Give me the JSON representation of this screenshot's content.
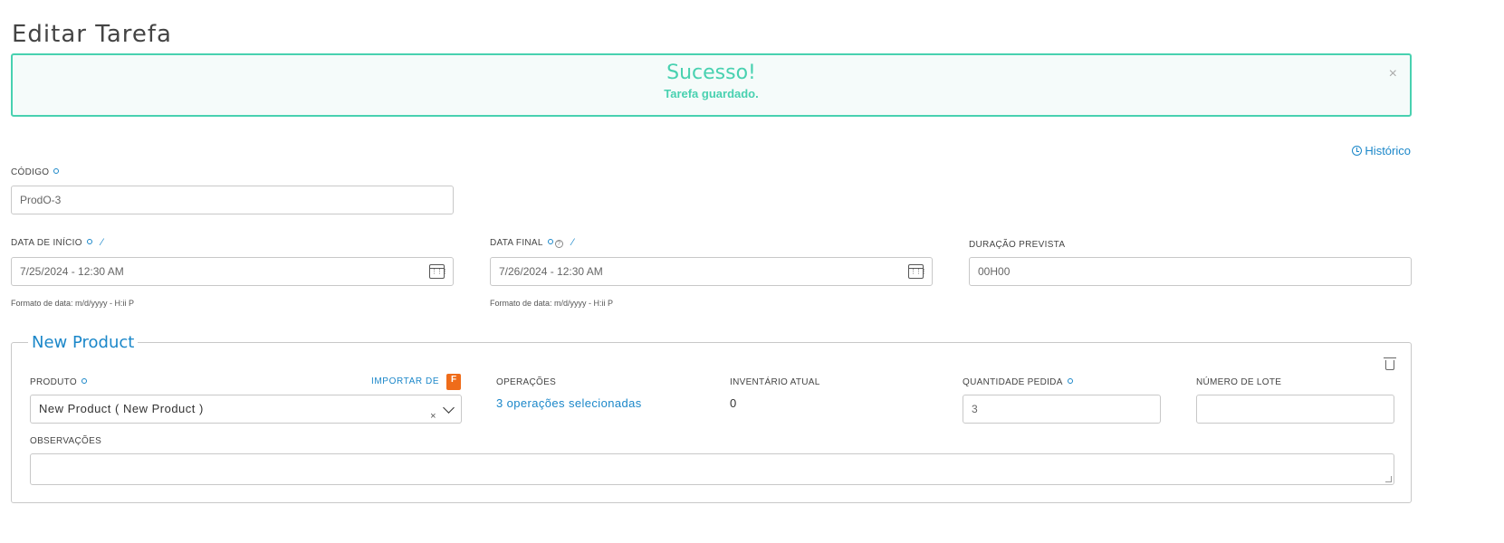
{
  "page": {
    "title": "Editar Tarefa"
  },
  "alert": {
    "title": "Sucesso!",
    "message": "Tarefa guardado.",
    "close_symbol": "×"
  },
  "history": {
    "label": "Histórico",
    "icon": "clock-icon"
  },
  "form": {
    "codigo": {
      "label": "CÓDIGO",
      "value": "ProdO-3"
    },
    "data_inicio": {
      "label": "DATA DE INÍCIO",
      "value": "7/25/2024 - 12:30 AM",
      "hint": "Formato de data: m/d/yyyy - H:ii P"
    },
    "data_final": {
      "label": "DATA FINAL",
      "value": "7/26/2024 - 12:30 AM",
      "hint": "Formato de data: m/d/yyyy - H:ii P"
    },
    "duracao": {
      "label": "DURAÇÃO PREVISTA",
      "value": "00H00"
    }
  },
  "product_section": {
    "legend": "New Product",
    "produto": {
      "label": "PRODUTO",
      "import_label": "IMPORTAR DE",
      "import_badge": "F",
      "selected": "New Product ( New Product )",
      "clear_symbol": "×"
    },
    "operacoes": {
      "label": "OPERAÇÕES",
      "value": "3 operações selecionadas"
    },
    "inventario": {
      "label": "INVENTÁRIO ATUAL",
      "value": "0"
    },
    "quantidade": {
      "label": "QUANTIDADE PEDIDA",
      "value": "3"
    },
    "lote": {
      "label": "NÚMERO DE LOTE",
      "value": ""
    },
    "observacoes": {
      "label": "OBSERVAÇÕES",
      "value": ""
    }
  },
  "colors": {
    "accent": "#1b87c9",
    "success": "#48d1b0",
    "import_badge": "#ef6c1a"
  }
}
